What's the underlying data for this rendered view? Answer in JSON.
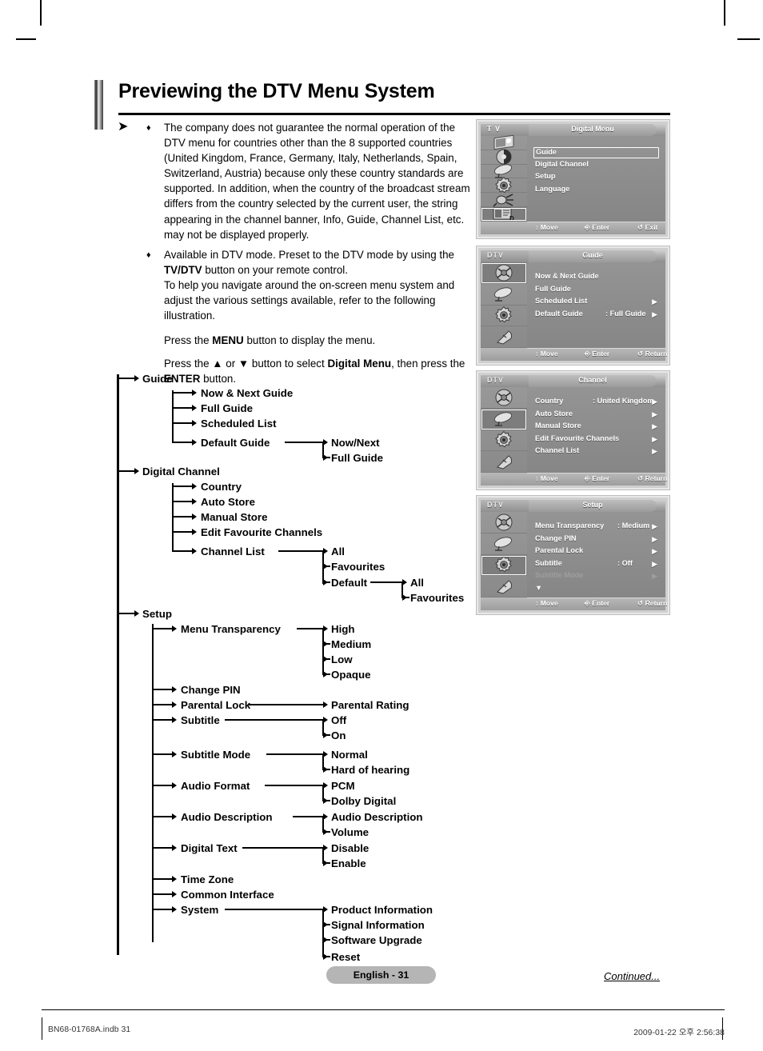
{
  "page": {
    "title": "Previewing the DTV Menu System",
    "badge": "English - 31",
    "continued": "Continued...",
    "footer_left": "BN68-01768A.indb   31",
    "footer_right": "2009-01-22   오후 2:56:38"
  },
  "intro": {
    "note_arrow": "➤",
    "bullet": "♦",
    "note1_a": "The company does not guarantee the normal operation of the DTV menu for countries other than the 8 supported countries (United Kingdom, France, Germany, Italy, Netherlands, Spain, Switzerland, Austria) because only these country standards are supported. In addition, when the country of the broadcast stream differs from the country selected by the current user, the string appearing in the channel banner, Info, Guide, Channel List, etc. may not be displayed properly.",
    "note2_a": "Available in DTV mode. Preset to the DTV mode by using the ",
    "note2_b": "TV/DTV",
    "note2_c": " button on your remote control.",
    "note2_d": "To help you navigate around the on-screen menu system and adjust the various settings available, refer to the following illustration.",
    "press1_a": "Press the ",
    "press1_b": "MENU",
    "press1_c": " button to display the menu.",
    "press2_a": "Press the ",
    "press2_b": "▲",
    "press2_c": " or ",
    "press2_d": "▼",
    "press2_e": " button to select ",
    "press2_f": "Digital Menu",
    "press2_g": ", then press the ",
    "press2_h": "ENTER",
    "press2_i": " button."
  },
  "tree": {
    "guide": "Guide",
    "guide_children": [
      "Now & Next Guide",
      "Full Guide",
      "Scheduled List",
      "Default Guide"
    ],
    "default_guide_children": [
      "Now/Next",
      "Full Guide"
    ],
    "digital_channel": "Digital Channel",
    "digital_channel_children": [
      "Country",
      "Auto Store",
      "Manual Store",
      "Edit Favourite Channels",
      "Channel List"
    ],
    "channel_list_children": [
      "All",
      "Favourites",
      "Default"
    ],
    "channel_list_default_children": [
      "All",
      "Favourites"
    ],
    "setup": "Setup",
    "setup_children": [
      "Menu Transparency",
      "Change PIN",
      "Parental Lock",
      "Subtitle",
      "Subtitle Mode",
      "Audio Format",
      "Audio Description",
      "Digital Text",
      "Time Zone",
      "Common Interface",
      "System"
    ],
    "menu_transparency_children": [
      "High",
      "Medium",
      "Low",
      "Opaque"
    ],
    "parental_lock_children": [
      "Parental Rating"
    ],
    "subtitle_children": [
      "Off",
      "On"
    ],
    "subtitle_mode_children": [
      "Normal",
      "Hard of hearing"
    ],
    "audio_format_children": [
      "PCM",
      "Dolby Digital"
    ],
    "audio_description_children": [
      "Audio Description",
      "Volume"
    ],
    "digital_text_children": [
      "Disable",
      "Enable"
    ],
    "system_children": [
      "Product Information",
      "Signal Information",
      "Software Upgrade",
      "Reset"
    ]
  },
  "screens": [
    {
      "mode": "T V",
      "title": "Digital Menu",
      "icons": [
        "picture-icon",
        "sound-icon",
        "channel-dish-icon",
        "setup-gear-icon",
        "input-plug-icon",
        "digital-menu-icon"
      ],
      "selected_icon": 5,
      "items": [
        {
          "label": "Guide",
          "value": "",
          "caret": false,
          "boxed": true,
          "dim": false
        },
        {
          "label": "Digital Channel",
          "value": "",
          "caret": false,
          "boxed": false,
          "dim": false
        },
        {
          "label": "Setup",
          "value": "",
          "caret": false,
          "boxed": false,
          "dim": false
        },
        {
          "label": "Language",
          "value": "",
          "caret": false,
          "boxed": false,
          "dim": false
        }
      ],
      "hints": [
        {
          "icon": "↕",
          "label": "Move"
        },
        {
          "icon": "⎆",
          "label": "Enter"
        },
        {
          "icon": "↺",
          "label": "Exit"
        }
      ]
    },
    {
      "mode": "DTV",
      "title": "Guide",
      "icons": [
        "guide-icon",
        "channel-dish-icon",
        "setup-gear-icon",
        "language-mouse-icon"
      ],
      "selected_icon": 0,
      "items": [
        {
          "label": "Now & Next Guide",
          "value": "",
          "caret": false,
          "boxed": false,
          "dim": false
        },
        {
          "label": "Full Guide",
          "value": "",
          "caret": false,
          "boxed": false,
          "dim": false
        },
        {
          "label": "Scheduled List",
          "value": "",
          "caret": true,
          "boxed": false,
          "dim": false
        },
        {
          "label": "Default Guide",
          "value": ": Full Guide",
          "caret": true,
          "boxed": false,
          "dim": false
        }
      ],
      "hints": [
        {
          "icon": "↕",
          "label": "Move"
        },
        {
          "icon": "⎆",
          "label": "Enter"
        },
        {
          "icon": "↺",
          "label": "Return"
        }
      ]
    },
    {
      "mode": "DTV",
      "title": "Channel",
      "icons": [
        "guide-icon",
        "channel-dish-icon",
        "setup-gear-icon",
        "language-mouse-icon"
      ],
      "selected_icon": 1,
      "items": [
        {
          "label": "Country",
          "value": ": United Kingdom",
          "caret": true,
          "boxed": false,
          "dim": false
        },
        {
          "label": "Auto Store",
          "value": "",
          "caret": true,
          "boxed": false,
          "dim": false
        },
        {
          "label": "Manual Store",
          "value": "",
          "caret": true,
          "boxed": false,
          "dim": false
        },
        {
          "label": "Edit Favourite Channels",
          "value": "",
          "caret": true,
          "boxed": false,
          "dim": false
        },
        {
          "label": "Channel List",
          "value": "",
          "caret": true,
          "boxed": false,
          "dim": false
        }
      ],
      "hints": [
        {
          "icon": "↕",
          "label": "Move"
        },
        {
          "icon": "⎆",
          "label": "Enter"
        },
        {
          "icon": "↺",
          "label": "Return"
        }
      ]
    },
    {
      "mode": "DTV",
      "title": "Setup",
      "icons": [
        "guide-icon",
        "channel-dish-icon",
        "setup-gear-icon",
        "language-mouse-icon"
      ],
      "selected_icon": 2,
      "items": [
        {
          "label": "Menu Transparency",
          "value": ": Medium",
          "caret": true,
          "boxed": false,
          "dim": false
        },
        {
          "label": "Change PIN",
          "value": "",
          "caret": true,
          "boxed": false,
          "dim": false
        },
        {
          "label": "Parental Lock",
          "value": "",
          "caret": true,
          "boxed": false,
          "dim": false
        },
        {
          "label": "Subtitle",
          "value": ": Off",
          "caret": true,
          "boxed": false,
          "dim": false
        },
        {
          "label": "Subtitle Mode",
          "value": "",
          "caret": true,
          "boxed": false,
          "dim": true
        },
        {
          "label": "▼",
          "value": "",
          "caret": false,
          "boxed": false,
          "dim": false
        }
      ],
      "hints": [
        {
          "icon": "↕",
          "label": "Move"
        },
        {
          "icon": "⎆",
          "label": "Enter"
        },
        {
          "icon": "↺",
          "label": "Return"
        }
      ]
    }
  ]
}
